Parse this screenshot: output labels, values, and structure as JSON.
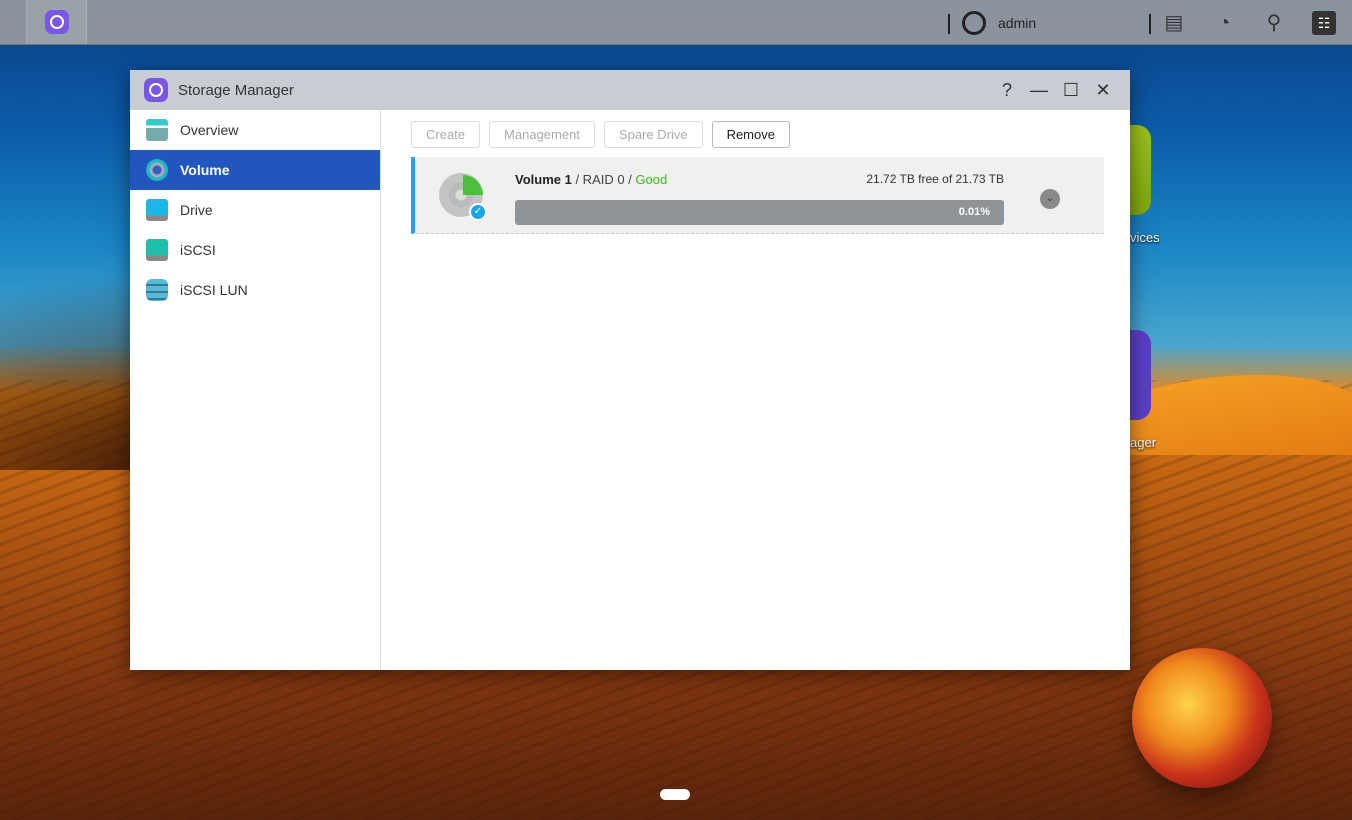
{
  "taskbar": {
    "user": "admin",
    "icons": [
      "storage-manager-icon",
      "notifications-icon",
      "dashboard-icon",
      "search-icon",
      "settings-icon"
    ]
  },
  "desktop": {
    "labels": [
      "vices",
      "ager"
    ]
  },
  "window": {
    "title": "Storage Manager",
    "controls": [
      "?",
      "—",
      "☐",
      "✕"
    ]
  },
  "sidebar": {
    "items": [
      {
        "label": "Overview"
      },
      {
        "label": "Volume"
      },
      {
        "label": "Drive"
      },
      {
        "label": "iSCSI"
      },
      {
        "label": "iSCSI LUN"
      }
    ]
  },
  "toolbar": {
    "create": "Create",
    "management": "Management",
    "spare": "Spare Drive",
    "remove": "Remove"
  },
  "volume": {
    "name": "Volume 1",
    "raid": " / RAID 0 / ",
    "status": "Good",
    "capacity": "21.72 TB free of 21.73 TB",
    "usage_label": "0.01%",
    "usage_percent": 0.01
  },
  "colors": {
    "accent": "#2355bf",
    "good": "#3bb51c"
  }
}
